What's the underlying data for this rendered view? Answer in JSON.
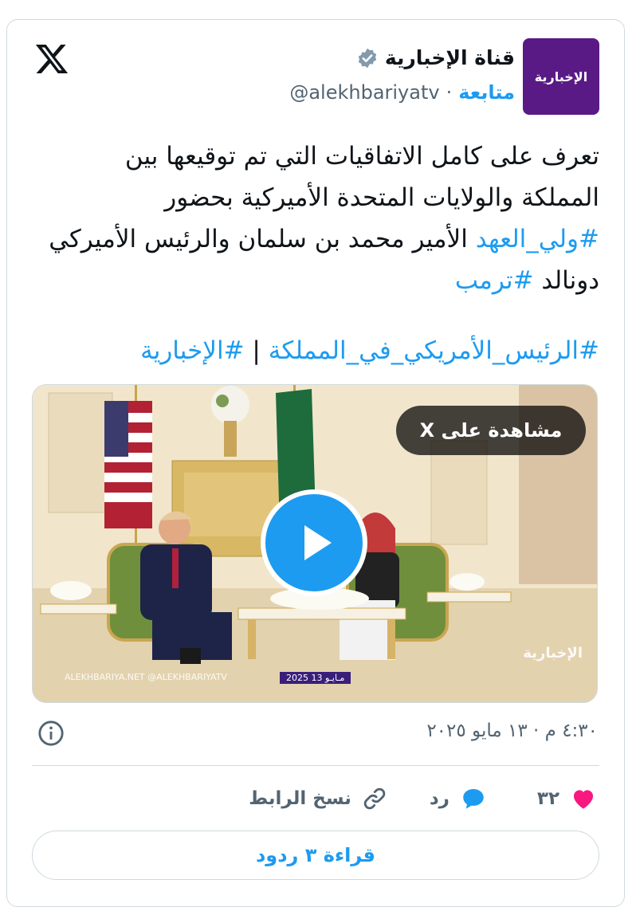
{
  "account": {
    "avatar_text": "الإخبارية",
    "name": "قناة الإخبارية",
    "handle": "@alekhbariyatv",
    "separator": "·",
    "follow_label": "متابعة"
  },
  "tweet": {
    "line1_text": "تعرف على كامل الاتفاقيات التي تم توقيعها بين المملكة والولايات المتحدة الأميركية بحضور ",
    "hashtag_crown_prince": "#ولي_العهد",
    "line2_text": " الأمير محمد بن سلمان والرئيس الأميركي دونالد ",
    "hashtag_trump": "#ترمب",
    "hashtag_president": "#الرئيس_الأمريكي_في_المملكة",
    "pipe": " | ",
    "hashtag_channel": "#الإخبارية"
  },
  "media": {
    "watch_label": "مشاهدة على X",
    "watermark": "ALEKHBARIYA.NET  @ALEKHBARIYATV",
    "date_badge": "2025 مـايـو 13",
    "logo_text": "الإخبارية"
  },
  "meta": {
    "timestamp": "٤:٣٠ م · ١٣ مايو ٢٠٢٥"
  },
  "actions": {
    "like_count": "٣٢",
    "reply_label": "رد",
    "copy_link_label": "نسخ الرابط"
  },
  "read_replies_label": "قراءة ٣ ردود",
  "colors": {
    "accent": "#1d9bf0",
    "like": "#f91880",
    "avatar_bg": "#5a1a86"
  }
}
